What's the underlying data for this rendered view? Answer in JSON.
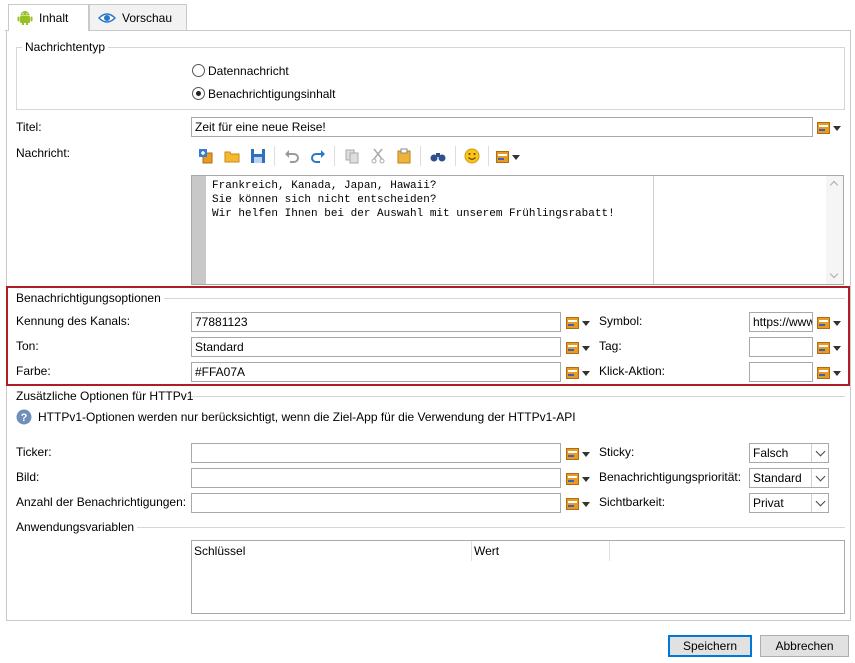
{
  "tabs": [
    {
      "label": "Inhalt",
      "icon": "android-icon"
    },
    {
      "label": "Vorschau",
      "icon": "eye-icon"
    }
  ],
  "message_type": {
    "legend": "Nachrichtentyp",
    "options": [
      "Datennachricht",
      "Benachrichtigungsinhalt"
    ],
    "selected": "Benachrichtigungsinhalt"
  },
  "title": {
    "label": "Titel:",
    "value": "Zeit für eine neue Reise!"
  },
  "message": {
    "label": "Nachricht:",
    "lines": [
      "Frankreich, Kanada, Japan, Hawaii?",
      "Sie können sich nicht entscheiden?",
      "Wir helfen Ihnen bei der Auswahl mit unserem Frühlingsrabatt!"
    ]
  },
  "notification_options": {
    "legend": "Benachrichtigungsoptionen",
    "highlight_color": "#b01c24",
    "channel": {
      "label": "Kennung des Kanals:",
      "value": "77881123"
    },
    "sound": {
      "label": "Ton:",
      "value": "Standard"
    },
    "color": {
      "label": "Farbe:",
      "value": "#FFA07A"
    },
    "symbol": {
      "label": "Symbol:",
      "value": "https://www"
    },
    "tag": {
      "label": "Tag:",
      "value": ""
    },
    "click_action": {
      "label": "Klick-Aktion:",
      "value": ""
    }
  },
  "httpv1": {
    "legend": "Zusätzliche Optionen für HTTPv1",
    "info": "HTTPv1-Optionen werden nur berücksichtigt, wenn die Ziel-App für die Verwendung der HTTPv1-API",
    "ticker": {
      "label": "Ticker:",
      "value": ""
    },
    "image": {
      "label": "Bild:",
      "value": ""
    },
    "count": {
      "label": "Anzahl der Benachrichtigungen:",
      "value": ""
    },
    "sticky": {
      "label": "Sticky:",
      "value": "Falsch"
    },
    "priority": {
      "label": "Benachrichtigungspriorität:",
      "value": "Standard"
    },
    "visibility": {
      "label": "Sichtbarkeit:",
      "value": "Privat"
    }
  },
  "app_variables": {
    "legend": "Anwendungsvariablen",
    "columns": [
      "Schlüssel",
      "Wert"
    ]
  },
  "buttons": {
    "save": "Speichern",
    "cancel": "Abbrechen"
  }
}
